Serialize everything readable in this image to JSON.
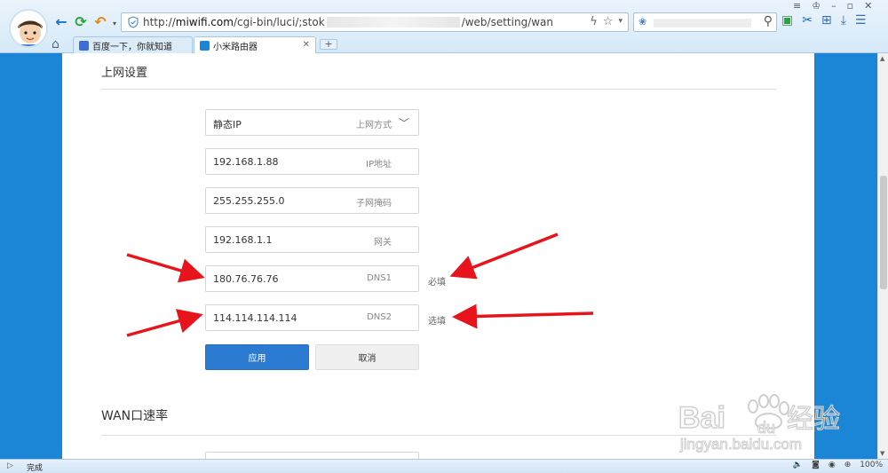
{
  "browser": {
    "address": {
      "prefix": "http://",
      "host": "miwifi.com",
      "path_start": "/cgi-bin/luci/;stok",
      "path_end": "/web/setting/wan"
    },
    "tabs": [
      {
        "label": "百度一下，你就知道",
        "active": false
      },
      {
        "label": "小米路由器",
        "active": true
      }
    ],
    "new_tab_label": "+"
  },
  "page": {
    "section1_title": "上网设置",
    "fields": [
      {
        "value": "静态IP",
        "label": "上网方式",
        "type": "select"
      },
      {
        "value": "192.168.1.88",
        "label": "IP地址"
      },
      {
        "value": "255.255.255.0",
        "label": "子网掩码"
      },
      {
        "value": "192.168.1.1",
        "label": "网关"
      },
      {
        "value": "180.76.76.76",
        "label": "DNS1",
        "note": "必填"
      },
      {
        "value": "114.114.114.114",
        "label": "DNS2",
        "note": "选填"
      }
    ],
    "apply_label": "应用",
    "cancel_label": "取消",
    "section2_title": "WAN口速率"
  },
  "status": {
    "text": "完成",
    "zoom": "100%"
  },
  "watermark": {
    "brand": "Bai",
    "brand_end": "经验",
    "url": "jingyan.baidu.com"
  },
  "colors": {
    "page_background": "#1b86d6",
    "apply_button": "#2c7bd3",
    "annotation_arrows": "#e8141b"
  }
}
